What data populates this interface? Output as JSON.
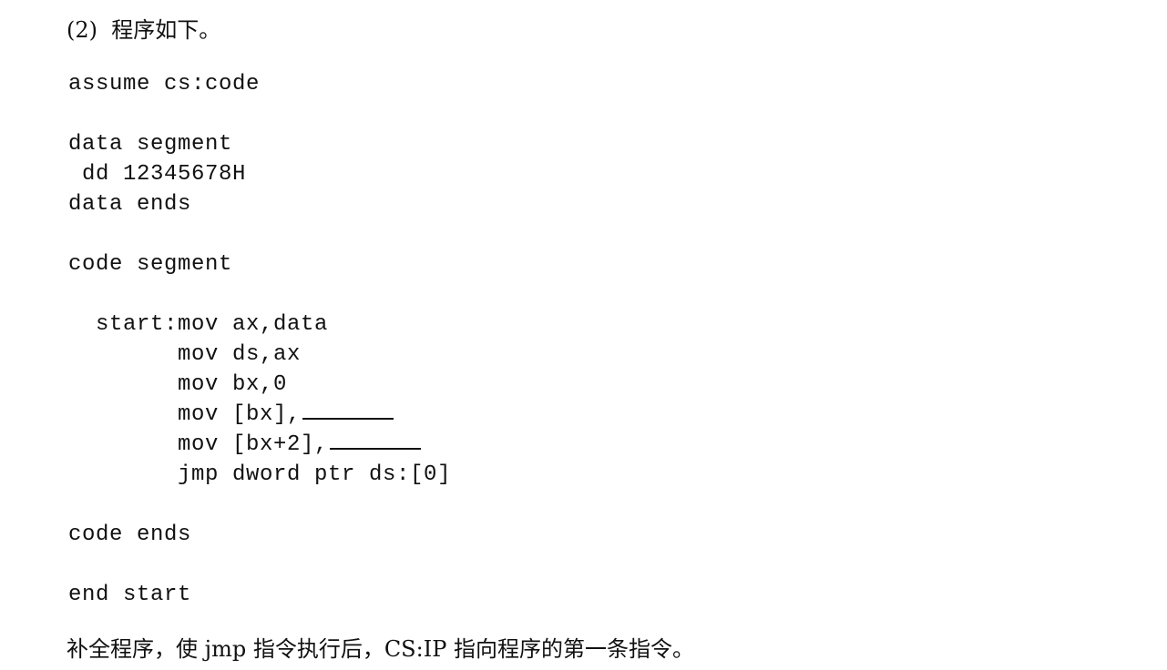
{
  "question": {
    "number": "(2)",
    "heading_text": "程序如下。",
    "instruction": "补全程序，使 jmp 指令执行后，CS:IP 指向程序的第一条指令。"
  },
  "code": {
    "lines": [
      {
        "text": "assume cs:code",
        "blank": false
      },
      {
        "text": "",
        "blank": false
      },
      {
        "text": "data segment",
        "blank": false
      },
      {
        "text": " dd 12345678H",
        "blank": false
      },
      {
        "text": "data ends",
        "blank": false
      },
      {
        "text": "",
        "blank": false
      },
      {
        "text": "code segment",
        "blank": false
      },
      {
        "text": "",
        "blank": false
      },
      {
        "text": "  start:mov ax,data",
        "blank": false
      },
      {
        "text": "        mov ds,ax",
        "blank": false
      },
      {
        "text": "        mov bx,0",
        "blank": false
      },
      {
        "text": "        mov [bx],",
        "blank": true
      },
      {
        "text": "        mov [bx+2],",
        "blank": true
      },
      {
        "text": "        jmp dword ptr ds:[0]",
        "blank": false
      },
      {
        "text": "",
        "blank": false
      },
      {
        "text": "code ends",
        "blank": false
      },
      {
        "text": "",
        "blank": false
      },
      {
        "text": "end start",
        "blank": false
      }
    ]
  }
}
